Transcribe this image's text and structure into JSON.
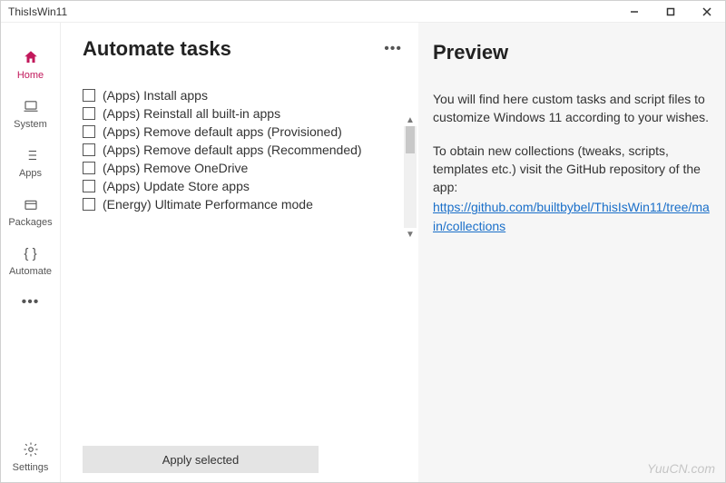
{
  "window": {
    "title": "ThisIsWin11"
  },
  "sidebar": {
    "items": [
      {
        "label": "Home"
      },
      {
        "label": "System"
      },
      {
        "label": "Apps"
      },
      {
        "label": "Packages"
      },
      {
        "label": "Automate"
      }
    ],
    "settings_label": "Settings"
  },
  "main": {
    "title": "Automate tasks",
    "tasks": [
      "(Apps) Install apps",
      "(Apps) Reinstall all built-in apps",
      "(Apps) Remove default apps (Provisioned)",
      "(Apps) Remove default apps (Recommended)",
      "(Apps) Remove OneDrive",
      "(Apps) Update Store apps",
      "(Energy) Ultimate Performance mode"
    ],
    "apply_label": "Apply selected"
  },
  "preview": {
    "title": "Preview",
    "para1": "You will find here custom tasks and script files to customize Windows 11 according to your wishes.",
    "para2": "To obtain new collections (tweaks, scripts, templates etc.) visit the GitHub repository of the app:",
    "link_text": "https://github.com/builtbybel/ThisIsWin11/tree/main/collections"
  },
  "watermark": "YuuCN.com"
}
